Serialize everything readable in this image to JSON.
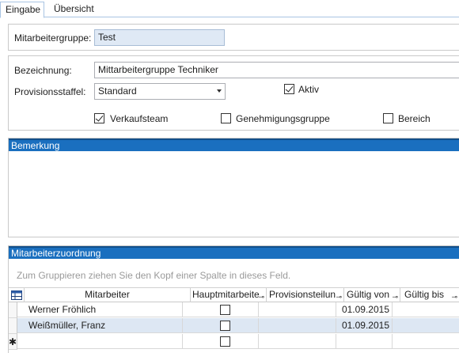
{
  "tabs": [
    {
      "label": "Eingabe"
    },
    {
      "label": "Übersicht"
    }
  ],
  "form": {
    "group_label": "Mitarbeitergruppe:",
    "group_value": "Test",
    "name_label": "Bezeichnung:",
    "name_value": "Mittarbeitergruppe Techniker",
    "staffel_label": "Provisionsstaffel:",
    "staffel_value": "Standard",
    "aktiv_label": "Aktiv",
    "verkauf_label": "Verkaufsteam",
    "genehm_label": "Genehmigungsgruppe",
    "bereich_label": "Bereich"
  },
  "bemerkung": {
    "title": "Bemerkung"
  },
  "zuordnung": {
    "title": "Mitarbeiterzuordnung",
    "group_hint": "Zum Gruppieren ziehen Sie den Kopf einer Spalte in dieses Feld.",
    "columns": [
      "Mitarbeiter",
      "Hauptmitarbeite",
      "Provisionsteilun",
      "Gültig von",
      "Gültig bis"
    ],
    "rows": [
      {
        "mitarbeiter": "Werner Fröhlich",
        "von": "01.09.2015",
        "bis": ""
      },
      {
        "mitarbeiter": "Weißmüller, Franz",
        "von": "01.09.2015",
        "bis": ""
      }
    ],
    "new_row_marker": "✱"
  },
  "state": {
    "aktiv_checked": true,
    "verkauf_checked": true,
    "genehm_checked": false,
    "bereich_checked": false
  }
}
